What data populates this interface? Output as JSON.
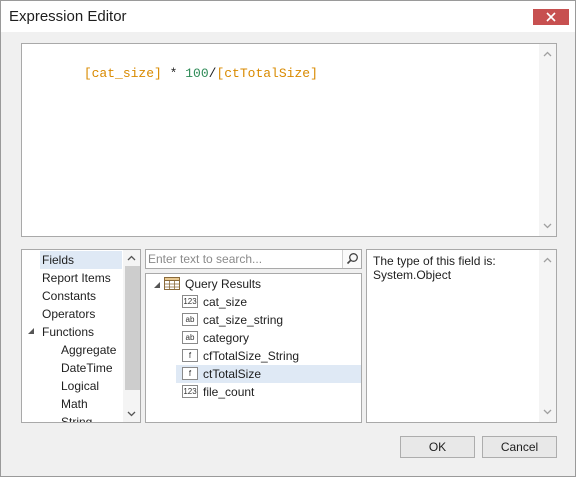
{
  "window": {
    "title": "Expression Editor"
  },
  "editor": {
    "tokens": [
      {
        "text": "[cat_size]",
        "kind": "field"
      },
      {
        "text": " * ",
        "kind": "op"
      },
      {
        "text": "100",
        "kind": "num"
      },
      {
        "text": "/",
        "kind": "op"
      },
      {
        "text": "[ctTotalSize]",
        "kind": "field"
      }
    ]
  },
  "categories": {
    "items": [
      {
        "label": "Fields",
        "selected": true
      },
      {
        "label": "Report Items"
      },
      {
        "label": "Constants"
      },
      {
        "label": "Operators"
      },
      {
        "label": "Functions",
        "expanded": true
      },
      {
        "label": "Aggregate"
      },
      {
        "label": "DateTime"
      },
      {
        "label": "Logical"
      },
      {
        "label": "Math"
      },
      {
        "label": "String"
      }
    ]
  },
  "search": {
    "placeholder": "Enter text to search..."
  },
  "fields": {
    "root": "Query Results",
    "items": [
      {
        "label": "cat_size",
        "icon": "123"
      },
      {
        "label": "cat_size_string",
        "icon": "ab"
      },
      {
        "label": "category",
        "icon": "ab"
      },
      {
        "label": "cfTotalSize_String",
        "icon": "f"
      },
      {
        "label": "ctTotalSize",
        "icon": "f",
        "selected": true
      },
      {
        "label": "file_count",
        "icon": "123"
      }
    ]
  },
  "description": {
    "text": "The type of this field is: System.Object"
  },
  "buttons": {
    "ok": "OK",
    "cancel": "Cancel"
  },
  "colors": {
    "field_token": "#d98a00",
    "number_token": "#2e8b57",
    "selection": "#dfe9f5",
    "close": "#c75050"
  }
}
